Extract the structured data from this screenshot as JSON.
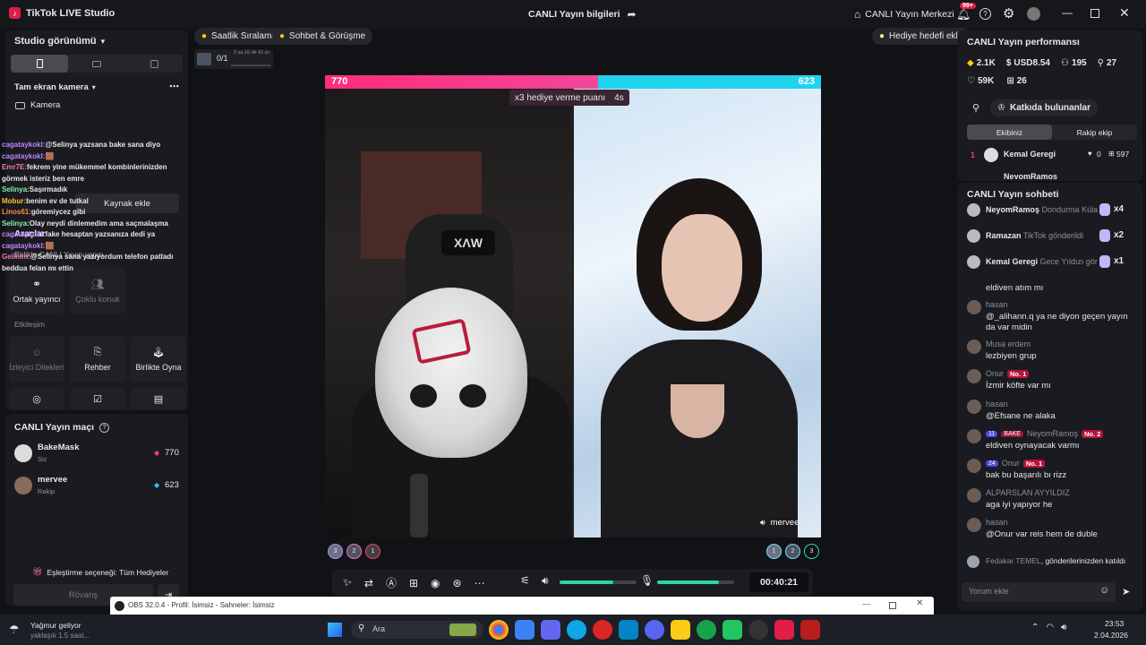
{
  "app": {
    "title": "TikTok LIVE Studio",
    "center_title": "CANLI Yayın bilgileri",
    "center_btn": "CANLI Yayın Merkezi",
    "notif_count": "99+"
  },
  "left": {
    "studio_view": "Studio görünümü",
    "fullscreen_cam": "Tam ekran kamera",
    "camera": "Kamera",
    "add_source": "Kaynak ekle",
    "tools_title": "Araçlar",
    "collab_live": "Birlikte CANLI Yayın yapın",
    "cohost": "Ortak yayıncı",
    "multi_guest": "Çoklu konuk",
    "interaction": "Etkileşim",
    "viewer_requests": "İzleyici Dilekleri",
    "guide": "Rehber",
    "play_together": "Birlikte Oyna",
    "match_title": "CANLI Yayın maçı",
    "match_players": [
      {
        "name": "BakeMask",
        "role": "Siz",
        "score": "770"
      },
      {
        "name": "mervee",
        "role": "Rakip",
        "score": "623"
      }
    ],
    "match_option": "Eşleştirme seçeneği: Tüm Hediyeler",
    "rematch": "Rövanş",
    "chat": [
      {
        "user": "cagataykokl:",
        "text": "@Selinya yazsana bake sana diyo",
        "color": "#c084fc"
      },
      {
        "user": "cagataykokl:",
        "text": "🟫",
        "color": "#c084fc"
      },
      {
        "user": "Emr7E:",
        "text": "fekrem yine mükemmel kombinlerinizden görmek isteriz ben emre",
        "color": "#f472b6"
      },
      {
        "user": "Selinya:",
        "text": "Saşırmadık",
        "color": "#86efac"
      },
      {
        "user": "Mobur:",
        "text": "benim ev de tutkal",
        "color": "#fbbf24"
      },
      {
        "user": "Linos61:",
        "text": "göremiycez gibi",
        "color": "#fb923c"
      },
      {
        "user": "Selinya:",
        "text": "Olay neydi dinlemedim ama saçmalaşma",
        "color": "#86efac"
      },
      {
        "user": "cagataykokl:",
        "text": "fake hesaptan yazsanıza dedi ya",
        "color": "#c084fc"
      },
      {
        "user": "cagataykokl:",
        "text": "🟫",
        "color": "#c084fc"
      },
      {
        "user": "Gelinim:",
        "text": "@Selinya sana yazıyordum telefon patladı beddua felan mı ettin",
        "color": "#f472b6"
      }
    ]
  },
  "top_pills": {
    "ranking": "Saatlik Sıralama",
    "chat_meet": "Sohbet & Görüşme",
    "gift_goal": "Hediye hedefi ekle",
    "goal": "0/1",
    "timer": "2 sa 16 dk 42 sn"
  },
  "battle": {
    "left_score": "770",
    "right_score": "623",
    "banner": "x3 hediye verme puanı",
    "banner_time": "4s",
    "opponent_name": "mervee",
    "left_score_fraction": 0.55,
    "left_ranks": [
      "3",
      "2",
      "1"
    ],
    "right_ranks": [
      "1",
      "2",
      "3"
    ]
  },
  "controls": {
    "time": "00:40:21",
    "volume": 0.7,
    "mic": 0.8
  },
  "right": {
    "perf_title": "CANLI Yayın performansı",
    "stats": [
      {
        "icon": "coin-icon",
        "value": "2.1K"
      },
      {
        "icon": "dollar-icon",
        "value": "USD8.54"
      },
      {
        "icon": "group-icon",
        "value": "195"
      },
      {
        "icon": "user-plus-icon",
        "value": "27"
      },
      {
        "icon": "heart-icon",
        "value": "59K"
      },
      {
        "icon": "gift-icon",
        "value": "26"
      }
    ],
    "contributors": "Katkıda bulunanlar",
    "tab_team": "Ekibiniz",
    "tab_rival": "Rakip ekip",
    "top_contrib": {
      "rank": "1",
      "name": "Kemal Geregi",
      "likes": "0",
      "gifts": "597"
    },
    "second_contrib": "NeyomRamoş",
    "chat_title": "CANLI Yayın sohbeti",
    "gift_rows": [
      {
        "name": "NeyomRamoş",
        "gift": "Dondurma Küla",
        "count": "x4"
      },
      {
        "name": "Ramazan",
        "gift": "TikTok gönderildi",
        "count": "x2"
      },
      {
        "name": "Kemal Geregi",
        "gift": "Gece Yıldızı gör",
        "count": "x1"
      }
    ],
    "comments": [
      {
        "name": "",
        "text": "eldiven atım mı",
        "badge": ""
      },
      {
        "name": "hasan",
        "text": "@_alihann.q ya ne diyon geçen yayın da var midin",
        "badge": ""
      },
      {
        "name": "Musa erdem",
        "text": "lezbiyen grup",
        "badge": ""
      },
      {
        "name": "Onur",
        "text": "İzmir köfte var mı",
        "badge": "No. 1"
      },
      {
        "name": "hasan",
        "text": "@Efsane ne alaka",
        "badge": ""
      },
      {
        "name": "NeyomRamoş",
        "text": "eldiven oynayacak varmı",
        "badge": "No. 2",
        "lvl": "11",
        "fan": "BAKE"
      },
      {
        "name": "Onur",
        "text": "bak bu başarılı bı rizz",
        "badge": "No. 1",
        "lvl": "24"
      },
      {
        "name": "ALPARSLAN AYYILDIZ",
        "text": "aga iyi yapıyor he",
        "badge": ""
      },
      {
        "name": "hasan",
        "text": "@Onur var reis hem de duble",
        "badge": ""
      }
    ],
    "sent_gift_name": "Fedakar TEMEL",
    "sent_gift_text": ", gönderilerinizden katıldı",
    "comment_placeholder": "Yorum ekle"
  },
  "obs": {
    "title": "OBS 32.0.4 - Profil: İsimsiz - Sahneler: İsimsiz"
  },
  "taskbar": {
    "weather_title": "Yağmur geliyor",
    "weather_sub": "yaklaşık 1.5 saat...",
    "search": "Ara",
    "time": "23:53",
    "date": "2.04.2026"
  }
}
